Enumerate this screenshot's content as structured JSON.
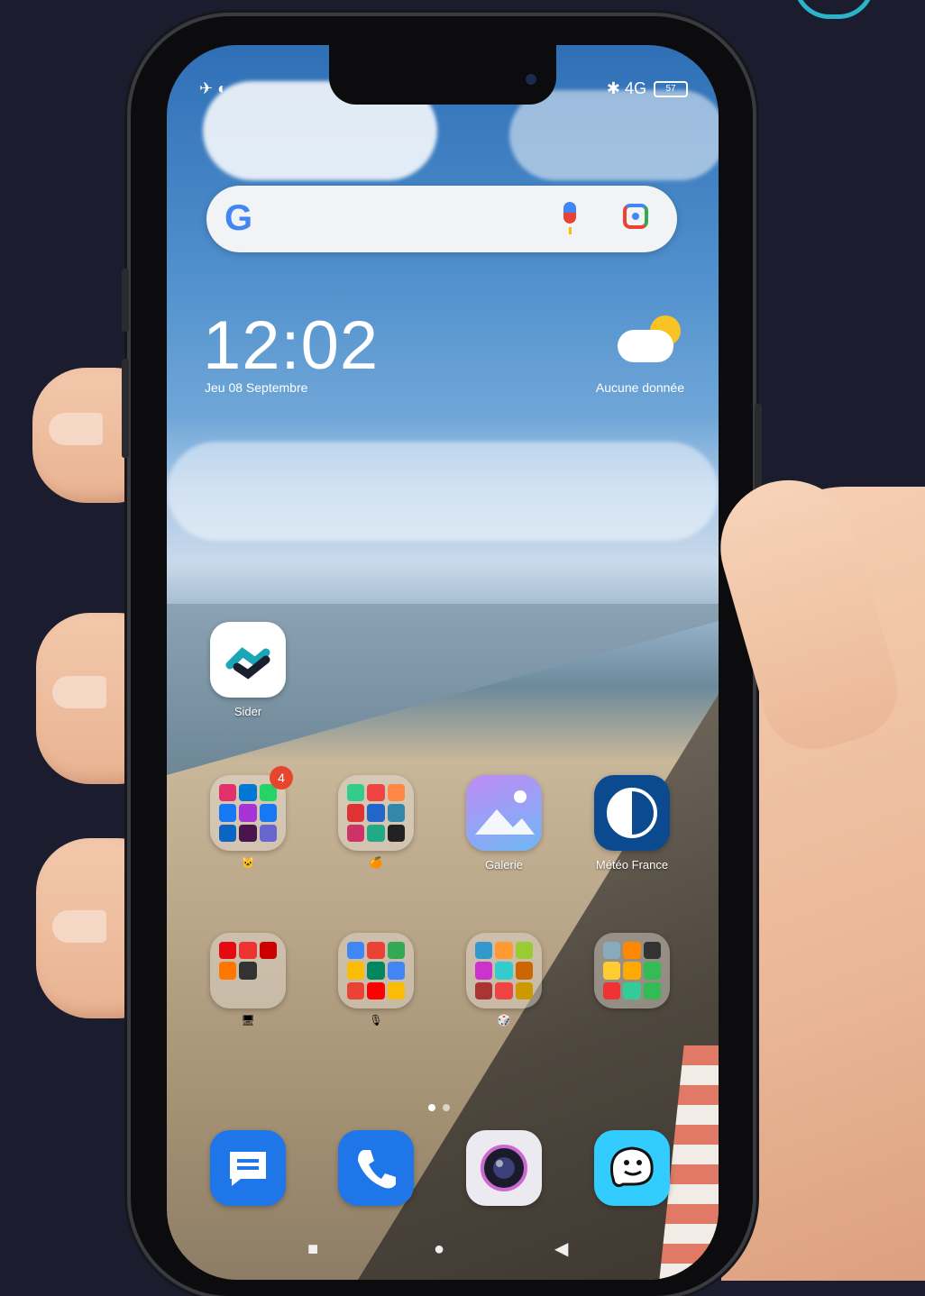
{
  "status_bar": {
    "left_icons": "✈︎ ◐",
    "right_icons": "✱ 4G",
    "battery": "57"
  },
  "search_bar": {
    "logo": "G",
    "icons": [
      "microphone-icon",
      "lens-camera-icon"
    ]
  },
  "clock_widget": {
    "time": "12:02",
    "date": "Jeu 08 Septembre"
  },
  "weather_widget": {
    "icon": "partly-cloudy-icon",
    "label": "Aucune donnée"
  },
  "apps": [
    {
      "label": "Sider",
      "color": "#ffffff"
    }
  ],
  "folders_row1": [
    {
      "badge": "4",
      "mark": "🐱"
    },
    {
      "mark": "🍊"
    },
    {
      "label": "Galerie"
    },
    {
      "label": "Météo France"
    }
  ],
  "folders_row2": [
    {
      "mark": "🖥"
    },
    {
      "mark": "🎙"
    },
    {
      "mark": "🎲"
    },
    {
      "mark": ""
    }
  ],
  "dock": [
    {
      "icon": "messages-icon",
      "color": "#1e76e8"
    },
    {
      "icon": "phone-icon",
      "color": "#1e76e8"
    },
    {
      "icon": "camera-icon",
      "color": "#eceaf0"
    },
    {
      "icon": "waze-icon",
      "color": "#33ccff"
    }
  ],
  "nav_bar": {
    "recents": "■",
    "home": "●",
    "back": "◀"
  }
}
